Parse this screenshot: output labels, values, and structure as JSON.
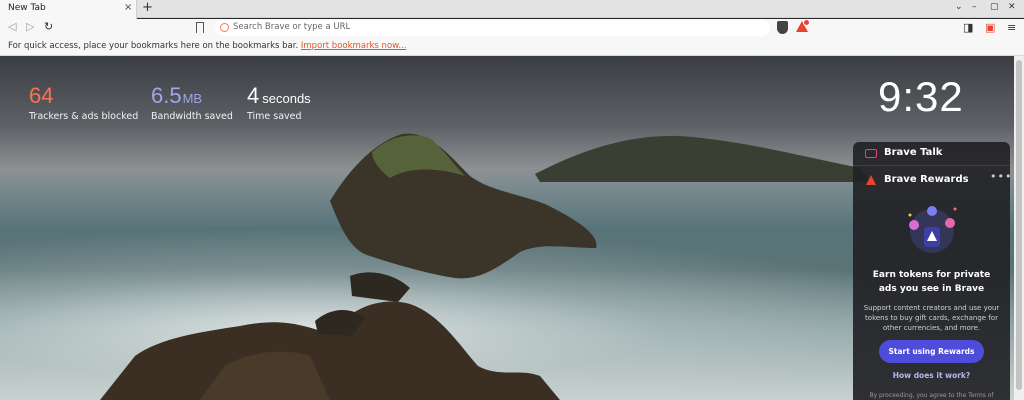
{
  "tabs": [
    {
      "title": "New Tab",
      "close": "×"
    }
  ],
  "new_tab": "+",
  "window_controls": {
    "dropdown": "⌄",
    "minimize": "–",
    "maximize": "▢",
    "close": "✕"
  },
  "nav": {
    "back": "◁",
    "forward": "▷",
    "reload": "↻"
  },
  "urlbar": {
    "placeholder": "Search Brave or type a URL"
  },
  "toolbar_right": {
    "sidebar": "◨",
    "wallet": "▣",
    "menu": "≡"
  },
  "bookmarks_bar": {
    "text": "For quick access, place your bookmarks here on the bookmarks bar.",
    "link": "Import bookmarks now..."
  },
  "stats": [
    {
      "value": "64",
      "unit": "",
      "label": "Trackers & ads blocked",
      "color": "#fa7250"
    },
    {
      "value": "6.5",
      "unit": "MB",
      "label": "Bandwidth saved",
      "color": "#a0a5eb"
    },
    {
      "value": "4",
      "unit": "seconds",
      "label": "Time saved",
      "color": "#ffffff"
    }
  ],
  "clock": "9:32",
  "widget": {
    "talk_title": "Brave Talk",
    "rewards_title": "Brave Rewards",
    "more": "•••",
    "headline": "Earn tokens for private ads you see in Brave",
    "body": "Support content creators and use your tokens to buy gift cards, exchange for other currencies, and more.",
    "button": "Start using Rewards",
    "how_link": "How does it work?",
    "terms": "By proceeding, you agree to the Terms of"
  },
  "colors": {
    "accent": "#e8432f",
    "rewards_button": "#4d4dd9",
    "link": "#e0552d"
  }
}
